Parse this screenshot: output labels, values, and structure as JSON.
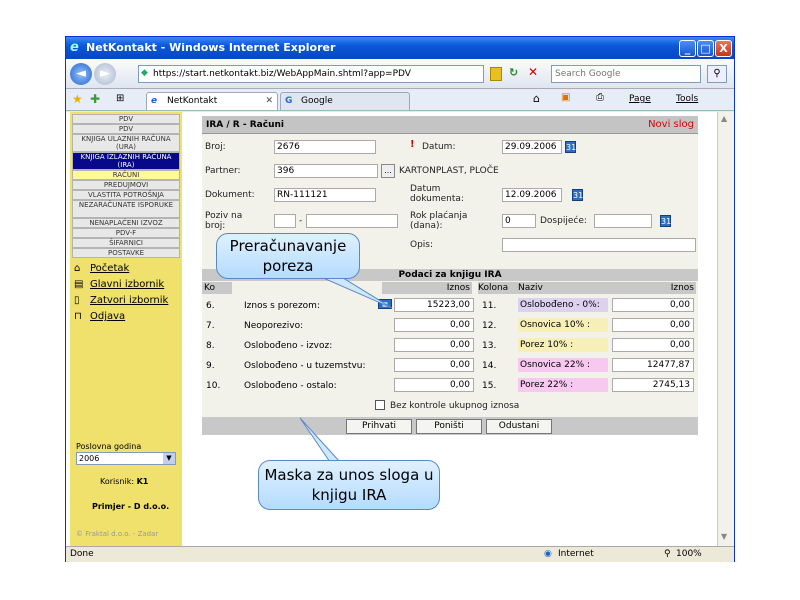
{
  "window": {
    "title": "NetKontakt - Windows Internet Explorer",
    "min": "_",
    "max": "□",
    "close": "X"
  },
  "address": {
    "url": "https://start.netkontakt.biz/WebAppMain.shtml?app=PDV",
    "search_placeholder": "Search Google",
    "back": "◄",
    "forward": "►"
  },
  "tabs": [
    {
      "label": "NetKontakt"
    },
    {
      "label": "Google"
    }
  ],
  "toolbar": {
    "page": "Page",
    "tools": "Tools"
  },
  "sidebar": {
    "menu": [
      {
        "label": "PDV"
      },
      {
        "label": "PDV"
      },
      {
        "label": "KNJIGA ULAZNIH RAČUNA (URA)"
      },
      {
        "label": "KNJIGA IZLAZNIH RAČUNA (IRA)"
      },
      {
        "label": "RAČUNI"
      },
      {
        "label": "PREDUJMOVI"
      },
      {
        "label": "VLASTITA POTROŠNJA"
      },
      {
        "label": "NEZARAČUNATE ISPORUKE"
      },
      {
        "label": "NENAPLAĆENI IZVOZ"
      },
      {
        "label": "PDV-F"
      },
      {
        "label": "ŠIFARNICI"
      },
      {
        "label": "POSTAVKE"
      }
    ],
    "links": [
      {
        "label": "Početak"
      },
      {
        "label": "Glavni izbornik"
      },
      {
        "label": "Zatvori izbornik"
      },
      {
        "label": "Odjava"
      }
    ],
    "year_label": "Poslovna godina",
    "year_value": "2006",
    "user_label": "Korisnik:",
    "user_value": "K1",
    "company": "Primjer - D d.o.o.",
    "copyright": "© Fraktal d.o.o. - Zadar"
  },
  "form": {
    "title": "IRA / R - Računi",
    "new_record": "Novi slog",
    "broj_label": "Broj:",
    "broj_value": "2676",
    "datum_label": "Datum:",
    "datum_value": "29.09.2006",
    "partner_label": "Partner:",
    "partner_code": "396",
    "partner_name": "KARTONPLAST, PLOČE",
    "dokument_label": "Dokument:",
    "dokument_value": "RN-111121",
    "datum_dok_label": "Datum dokumenta:",
    "datum_dok_value": "12.09.2006",
    "poziv_label": "Poziv na broj:",
    "rok_label": "Rok plaćanja (dana):",
    "rok_value": "0",
    "dospijece_label": "Dospijeće:",
    "opis_label": "Opis:",
    "grid_title": "Podaci za knjigu IRA",
    "col_kolona": "Kolona",
    "col_naziv": "Naziv",
    "col_iznos": "Iznos",
    "col_iznos_left": "Iznos",
    "col_k_left": "Ko",
    "rows_left": [
      {
        "num": "6.",
        "label": "Iznos s porezom:",
        "value": "15223,00"
      },
      {
        "num": "7.",
        "label": "Neoporezivo:",
        "value": "0,00"
      },
      {
        "num": "8.",
        "label": "Oslobođeno - izvoz:",
        "value": "0,00"
      },
      {
        "num": "9.",
        "label": "Oslobođeno - u tuzemstvu:",
        "value": "0,00"
      },
      {
        "num": "10.",
        "label": "Oslobođeno - ostalo:",
        "value": "0,00"
      }
    ],
    "rows_right": [
      {
        "num": "11.",
        "label": "Oslobođeno - 0%:",
        "value": "0,00",
        "color": "#dcd2f0"
      },
      {
        "num": "12.",
        "label": "Osnovica 10% :",
        "value": "0,00",
        "color": "#f6f0b8"
      },
      {
        "num": "13.",
        "label": "Porez 10% :",
        "value": "0,00",
        "color": "#f6f0b8"
      },
      {
        "num": "14.",
        "label": "Osnovica 22% :",
        "value": "12477,87",
        "color": "#f7c8f0"
      },
      {
        "num": "15.",
        "label": "Porez 22% :",
        "value": "2745,13",
        "color": "#f7c8f0"
      }
    ],
    "no_control_label": "Bez kontrole ukupnog iznosa",
    "btn_accept": "Prihvati",
    "btn_cancel": "Poništi",
    "btn_quit": "Odustani"
  },
  "status": {
    "left": "Done",
    "zone": "Internet",
    "zoom": "100%"
  },
  "callouts": {
    "top": "Preračunavanje poreza",
    "bottom": "Maska za unos sloga u knjigu IRA"
  }
}
